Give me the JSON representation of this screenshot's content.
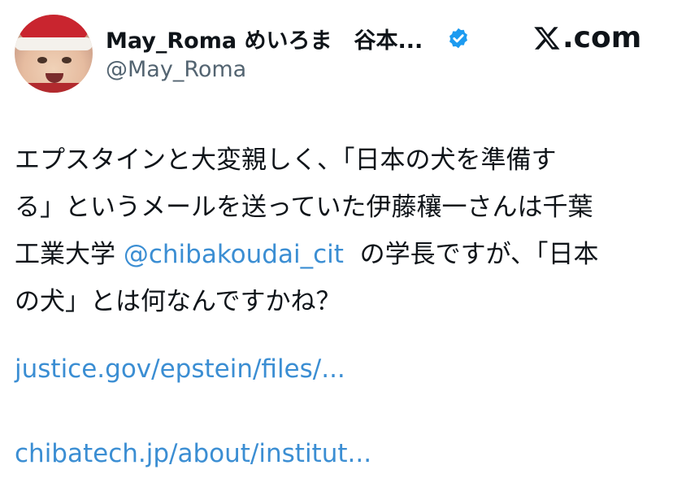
{
  "author": {
    "display_name": "May_Roma めいろま　谷本...",
    "handle": "@May_Roma",
    "verified": true
  },
  "brand": {
    "label": ".com"
  },
  "tweet": {
    "line1": "エプスタインと大変親しく、「日本の犬を準備す",
    "line2": "る」というメールを送っていた伊藤穰一さんは千葉",
    "line3_before": "工業大学 ",
    "line3_mention": "@chibakoudai_cit",
    "line3_after": "  の学長ですが、「日本",
    "line4": "の犬」とは何なんですかね？"
  },
  "links": {
    "link1": "justice.gov/epstein/files/...",
    "link2": "chibatech.jp/about/institut..."
  },
  "colors": {
    "link": "#3b8ed3",
    "verified_badge": "#1d9bf0",
    "handle": "#536471",
    "text": "#0f1419"
  },
  "icons": {
    "verified": "verified-badge-icon",
    "brand": "x-logo-icon"
  }
}
